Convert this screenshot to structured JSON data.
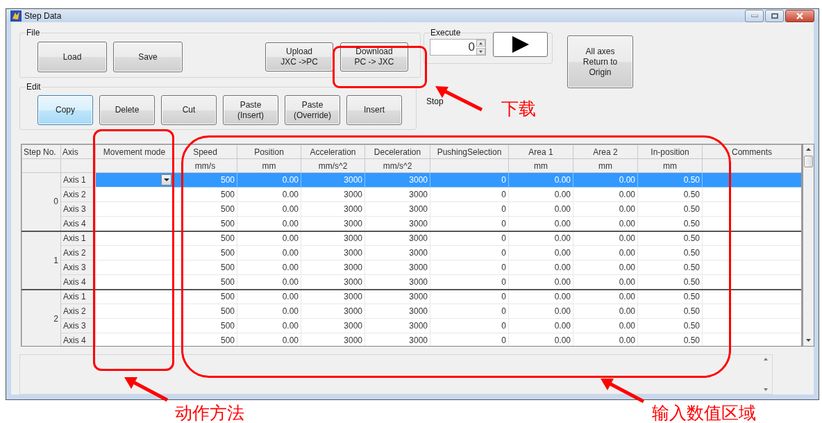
{
  "window": {
    "title": "Step Data"
  },
  "file_group": {
    "label": "File",
    "buttons": [
      {
        "lines": [
          "Load"
        ]
      },
      {
        "lines": [
          "Save"
        ]
      }
    ],
    "transfer_buttons": [
      {
        "lines": [
          "Upload",
          "JXC ->PC"
        ]
      },
      {
        "lines": [
          "Download",
          "PC -> JXC"
        ]
      }
    ]
  },
  "edit_group": {
    "label": "Edit",
    "buttons": [
      {
        "lines": [
          "Copy"
        ],
        "focused": true
      },
      {
        "lines": [
          "Delete"
        ],
        "focused": false
      },
      {
        "lines": [
          "Cut"
        ],
        "focused": false
      },
      {
        "lines": [
          "Paste",
          "(Insert)"
        ],
        "focused": false
      },
      {
        "lines": [
          "Paste",
          "(Override)"
        ],
        "focused": false
      },
      {
        "lines": [
          "Insert"
        ],
        "focused": false
      }
    ]
  },
  "execute_group": {
    "label": "Execute",
    "step_value": "0"
  },
  "stop_label": "Stop",
  "origin_button": {
    "lines": [
      "All axes",
      "Return to",
      "Origin"
    ]
  },
  "table": {
    "columns": [
      {
        "name": "Step No."
      },
      {
        "name": "Axis"
      },
      {
        "name": "Movement mode"
      },
      {
        "name": "Speed",
        "unit": "mm/s"
      },
      {
        "name": "Position",
        "unit": "mm"
      },
      {
        "name": "Acceleration",
        "unit": "mm/s^2"
      },
      {
        "name": "Deceleration",
        "unit": "mm/s^2"
      },
      {
        "name": "PushingSelection"
      },
      {
        "name": "Area 1",
        "unit": "mm"
      },
      {
        "name": "Area 2",
        "unit": "mm"
      },
      {
        "name": "In-position",
        "unit": "mm"
      },
      {
        "name": "Comments"
      }
    ],
    "steps": [
      {
        "step": "0",
        "rows": [
          {
            "axis": "Axis 1",
            "selected": true,
            "values": [
              "500",
              "0.00",
              "3000",
              "3000",
              "0",
              "0.00",
              "0.00",
              "0.50"
            ]
          },
          {
            "axis": "Axis 2",
            "selected": false,
            "values": [
              "500",
              "0.00",
              "3000",
              "3000",
              "0",
              "0.00",
              "0.00",
              "0.50"
            ]
          },
          {
            "axis": "Axis 3",
            "selected": false,
            "values": [
              "500",
              "0.00",
              "3000",
              "3000",
              "0",
              "0.00",
              "0.00",
              "0.50"
            ]
          },
          {
            "axis": "Axis 4",
            "selected": false,
            "values": [
              "500",
              "0.00",
              "3000",
              "3000",
              "0",
              "0.00",
              "0.00",
              "0.50"
            ]
          }
        ]
      },
      {
        "step": "1",
        "rows": [
          {
            "axis": "Axis 1",
            "selected": false,
            "values": [
              "500",
              "0.00",
              "3000",
              "3000",
              "0",
              "0.00",
              "0.00",
              "0.50"
            ]
          },
          {
            "axis": "Axis 2",
            "selected": false,
            "values": [
              "500",
              "0.00",
              "3000",
              "3000",
              "0",
              "0.00",
              "0.00",
              "0.50"
            ]
          },
          {
            "axis": "Axis 3",
            "selected": false,
            "values": [
              "500",
              "0.00",
              "3000",
              "3000",
              "0",
              "0.00",
              "0.00",
              "0.50"
            ]
          },
          {
            "axis": "Axis 4",
            "selected": false,
            "values": [
              "500",
              "0.00",
              "3000",
              "3000",
              "0",
              "0.00",
              "0.00",
              "0.50"
            ]
          }
        ]
      },
      {
        "step": "2",
        "rows": [
          {
            "axis": "Axis 1",
            "selected": false,
            "values": [
              "500",
              "0.00",
              "3000",
              "3000",
              "0",
              "0.00",
              "0.00",
              "0.50"
            ]
          },
          {
            "axis": "Axis 2",
            "selected": false,
            "values": [
              "500",
              "0.00",
              "3000",
              "3000",
              "0",
              "0.00",
              "0.00",
              "0.50"
            ]
          },
          {
            "axis": "Axis 3",
            "selected": false,
            "values": [
              "500",
              "0.00",
              "3000",
              "3000",
              "0",
              "0.00",
              "0.00",
              "0.50"
            ]
          },
          {
            "axis": "Axis 4",
            "selected": false,
            "values": [
              "500",
              "0.00",
              "3000",
              "3000",
              "0",
              "0.00",
              "0.00",
              "0.50"
            ]
          }
        ]
      }
    ]
  },
  "annotations": [
    {
      "text": "下载"
    },
    {
      "text": "动作方法"
    },
    {
      "text": "输入数值区域"
    }
  ]
}
